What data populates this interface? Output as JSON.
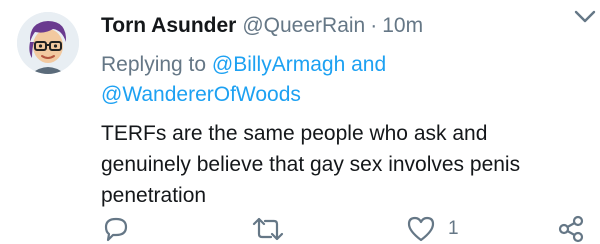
{
  "tweet": {
    "display_name": "Torn Asunder",
    "handle": "@QueerRain",
    "separator": "·",
    "time": "10m",
    "replying_prefix": "Replying to",
    "reply_user_1": "@BillyArmagh",
    "reply_and": "and",
    "reply_user_2": "@WandererOfWoods",
    "body": "TERFs are the same people who ask and genuinely believe that gay sex involves penis penetration"
  },
  "actions": {
    "reply_icon": "reply-icon",
    "retweet_icon": "retweet-icon",
    "like_icon": "heart-icon",
    "like_count": "1",
    "share_icon": "share-icon"
  },
  "colors": {
    "link": "#1da1f2",
    "secondary": "#657786",
    "text": "#14171a",
    "avatar_hair": "#6a3a8f"
  }
}
